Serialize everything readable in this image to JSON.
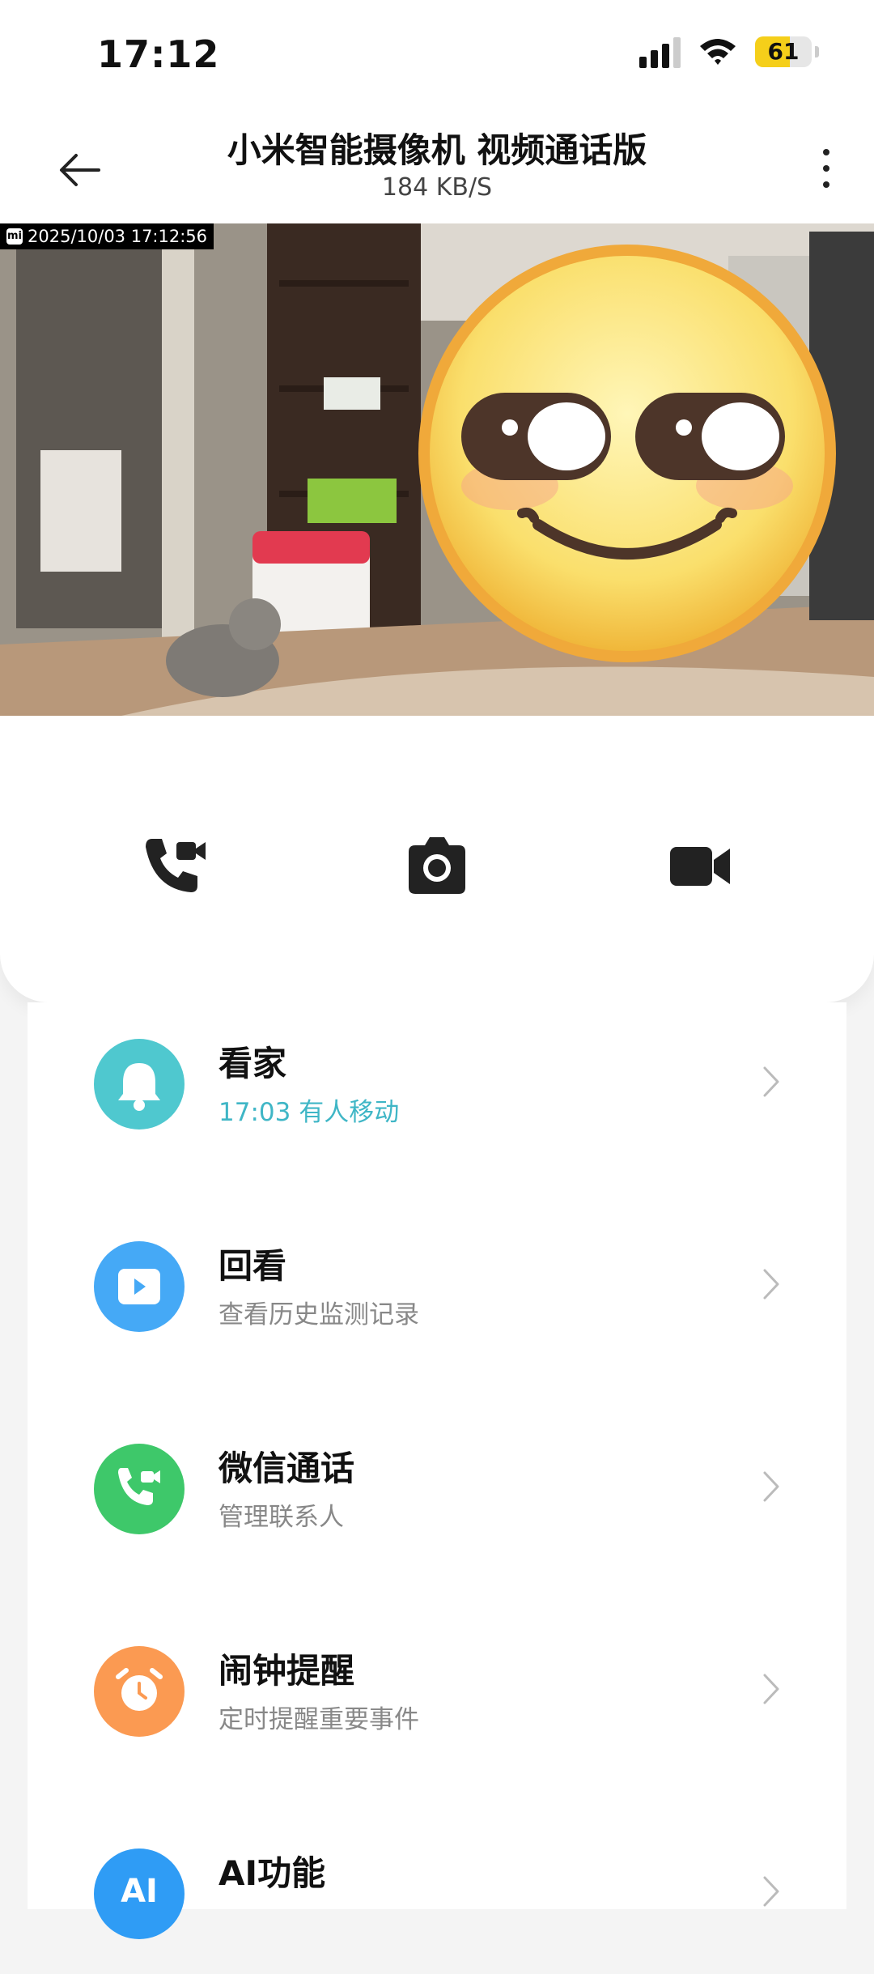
{
  "status": {
    "time": "17:12",
    "battery": "61",
    "battery_level": 0.61
  },
  "nav": {
    "title": "小米智能摄像机 视频通话版",
    "subtitle": "184 KB/S"
  },
  "video": {
    "timestamp": "2025/10/03 17:12:56",
    "logo_text": "mi"
  },
  "actions": [
    {
      "name": "video-call",
      "icon": "phone-video-icon"
    },
    {
      "name": "snapshot",
      "icon": "camera-icon"
    },
    {
      "name": "record",
      "icon": "video-camera-icon"
    }
  ],
  "list": [
    {
      "title": "看家",
      "subtitle": "17:03 有人移动",
      "icon": "bell-icon",
      "color": "#4fc8cf"
    },
    {
      "title": "回看",
      "subtitle": "查看历史监测记录",
      "icon": "play-icon",
      "color": "#45a9f6"
    },
    {
      "title": "微信通话",
      "subtitle": "管理联系人",
      "icon": "phone-video-icon",
      "color": "#3ec86a"
    },
    {
      "title": "闹钟提醒",
      "subtitle": "定时提醒重要事件",
      "icon": "alarm-clock-icon",
      "color": "#fb9a52"
    },
    {
      "title": "AI功能",
      "subtitle": "",
      "icon": "ai-icon",
      "color": "#2f9cf5",
      "badge": "AI"
    }
  ]
}
